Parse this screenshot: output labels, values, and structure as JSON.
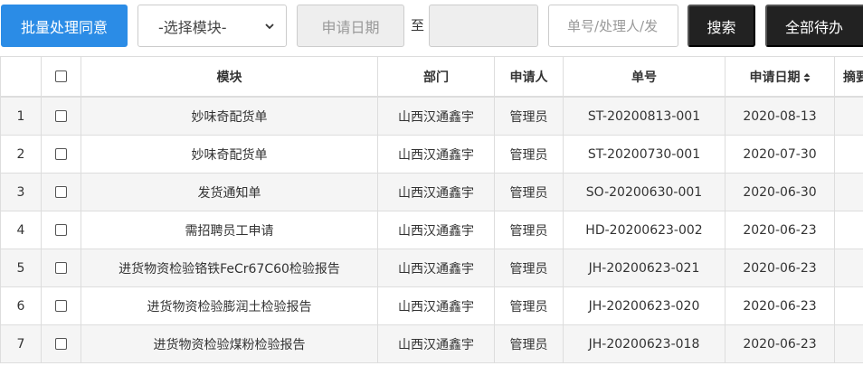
{
  "toolbar": {
    "batch_label": "批量处理同意",
    "module_select": {
      "value": "-选择模块-",
      "options": [
        "-选择模块-"
      ]
    },
    "date_from_placeholder": "申请日期",
    "to_label": "至",
    "date_to_placeholder": "",
    "search_placeholder": "单号/处理人/发",
    "search_label": "搜索",
    "all_pending_label": "全部待办"
  },
  "table": {
    "headers": {
      "index": "",
      "module": "模块",
      "dept": "部门",
      "applicant": "申请人",
      "number": "单号",
      "date": "申请日期",
      "summary": "摘要"
    },
    "rows": [
      {
        "index": "1",
        "module": "妙味奇配货单",
        "dept": "山西汉通鑫宇",
        "applicant": "管理员",
        "number": "ST-20200813-001",
        "date": "2020-08-13",
        "summary": ""
      },
      {
        "index": "2",
        "module": "妙味奇配货单",
        "dept": "山西汉通鑫宇",
        "applicant": "管理员",
        "number": "ST-20200730-001",
        "date": "2020-07-30",
        "summary": ""
      },
      {
        "index": "3",
        "module": "发货通知单",
        "dept": "山西汉通鑫宇",
        "applicant": "管理员",
        "number": "SO-20200630-001",
        "date": "2020-06-30",
        "summary": ""
      },
      {
        "index": "4",
        "module": "需招聘员工申请",
        "dept": "山西汉通鑫宇",
        "applicant": "管理员",
        "number": "HD-20200623-002",
        "date": "2020-06-23",
        "summary": ""
      },
      {
        "index": "5",
        "module": "进货物资检验铬铁FeCr67C60检验报告",
        "dept": "山西汉通鑫宇",
        "applicant": "管理员",
        "number": "JH-20200623-021",
        "date": "2020-06-23",
        "summary": ""
      },
      {
        "index": "6",
        "module": "进货物资检验膨润土检验报告",
        "dept": "山西汉通鑫宇",
        "applicant": "管理员",
        "number": "JH-20200623-020",
        "date": "2020-06-23",
        "summary": ""
      },
      {
        "index": "7",
        "module": "进货物资检验煤粉检验报告",
        "dept": "山西汉通鑫宇",
        "applicant": "管理员",
        "number": "JH-20200623-018",
        "date": "2020-06-23",
        "summary": ""
      }
    ]
  },
  "icons": {
    "select_chevron": "chevron-down-icon",
    "sort": "sort-icon",
    "checkbox": "checkbox-icon"
  },
  "colors": {
    "primary": "#2b8ce6",
    "dark_button": "#222222",
    "input_disabled_bg": "#eeeeee",
    "row_stripe": "#f5f5f5",
    "border": "#dddddd"
  }
}
